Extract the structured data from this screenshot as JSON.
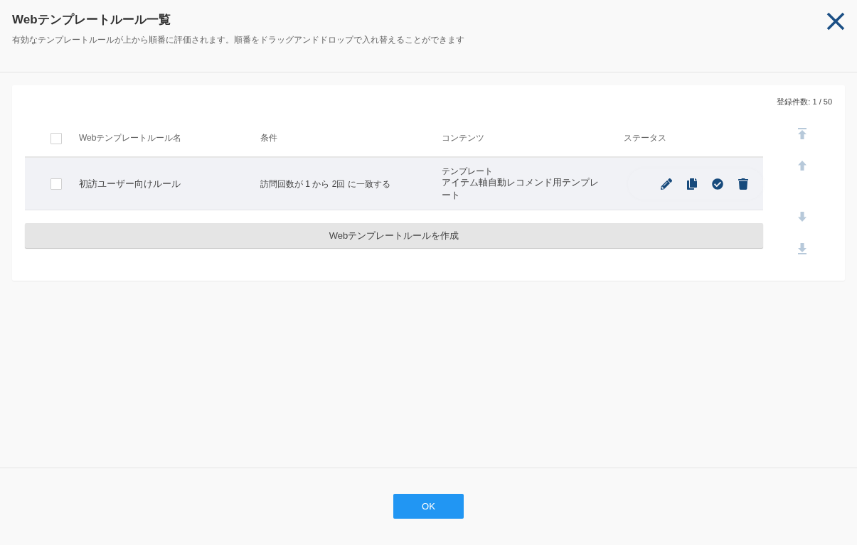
{
  "dialog": {
    "title": "Webテンプレートルール一覧",
    "description": "有効なテンプレートルールが上から順番に評価されます。順番をドラッグアンドドロップで入れ替えることができます"
  },
  "list": {
    "count": "登録件数: 1 / 50",
    "select_all": {
      "checked": false
    },
    "columns": [
      "Webテンプレートルール名",
      "条件",
      "コンテンツ",
      "ステータス"
    ],
    "rows": [
      {
        "checked": false,
        "name": "初訪ユーザー向けルール",
        "condition": "訪問回数が 1 から 2回 に一致する",
        "content_label": "テンプレート",
        "content": "アイテム軸自動レコメンド用テンプレート"
      }
    ],
    "create_button": "Webテンプレートルールを作成"
  },
  "footer": {
    "ok_button": "OK"
  }
}
